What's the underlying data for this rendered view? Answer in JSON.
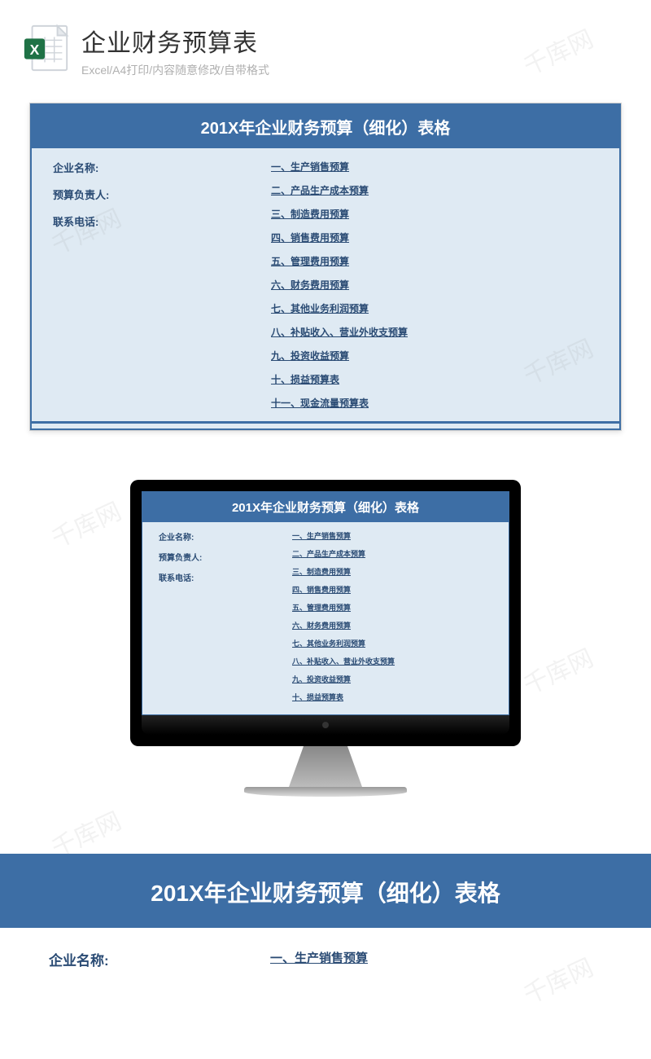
{
  "header": {
    "title": "企业财务预算表",
    "subtitle": "Excel/A4打印/内容随意修改/自带格式",
    "icon_badge": "X"
  },
  "document": {
    "title": "201X年企业财务预算（细化）表格",
    "fields": [
      "企业名称:",
      "预算负责人:",
      "联系电话:"
    ],
    "toc": [
      "一、生产销售预算",
      "二、产品生产成本预算",
      "三、制造费用预算",
      "四、销售费用预算",
      "五、管理费用预算",
      "六、财务费用预算",
      "七、其他业务利润预算",
      "八、补贴收入、营业外收支预算",
      "九、投资收益预算",
      "十、损益预算表",
      "十一、现金流量预算表"
    ],
    "toc_monitor_count": 10,
    "toc_large_count": 1
  },
  "watermark_text": "千库网"
}
